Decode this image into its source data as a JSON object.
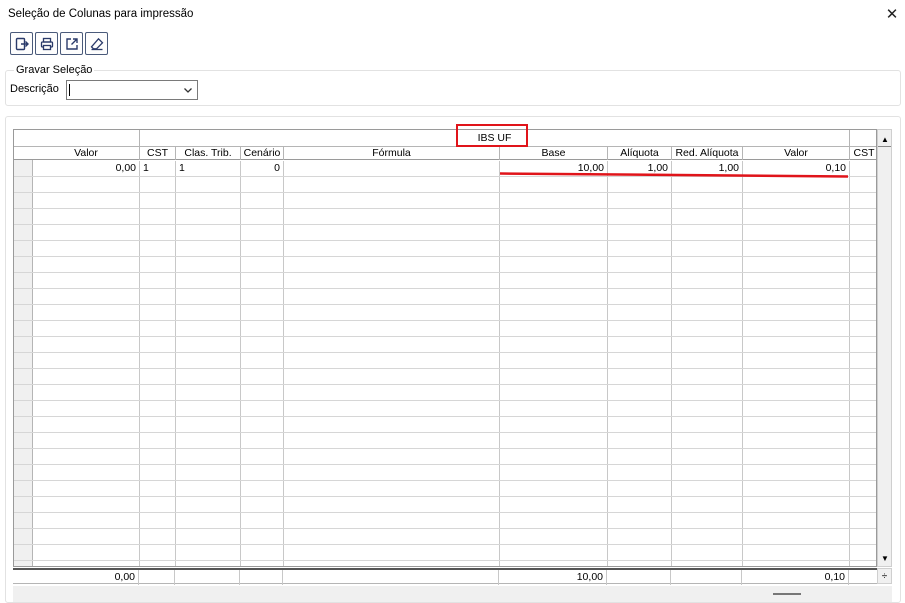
{
  "window": {
    "title": "Seleção de Colunas para impressão",
    "close_icon": "close-icon"
  },
  "toolbar": {
    "buttons": [
      {
        "name": "exit-button",
        "icon": "exit-icon"
      },
      {
        "name": "print-button",
        "icon": "printer-icon"
      },
      {
        "name": "export-button",
        "icon": "export-icon"
      },
      {
        "name": "clear-button",
        "icon": "eraser-icon"
      }
    ]
  },
  "selection_group": {
    "title": "Gravar Seleção",
    "description_label": "Descrição",
    "description_value": ""
  },
  "grid": {
    "band_label": "IBS UF",
    "columns": [
      "Valor",
      "CST",
      "Clas. Trib.",
      "Cenário",
      "Fórmula",
      "Base",
      "Alíquota",
      "Red. Alíquota",
      "Valor",
      "CST"
    ],
    "rows": [
      {
        "valor": "0,00",
        "cst": "1",
        "clas_trib": "1",
        "cenario": "0",
        "formula": "",
        "base": "10,00",
        "aliquota": "1,00",
        "red_aliquota": "1,00",
        "valor2": "0,10",
        "cst2": ""
      }
    ],
    "footer": {
      "valor": "0,00",
      "base": "10,00",
      "valor2": "0,10"
    }
  },
  "colors": {
    "highlight": "#e0141a",
    "grid_line": "#c8c8c8",
    "header_bg": "#ffffff"
  }
}
